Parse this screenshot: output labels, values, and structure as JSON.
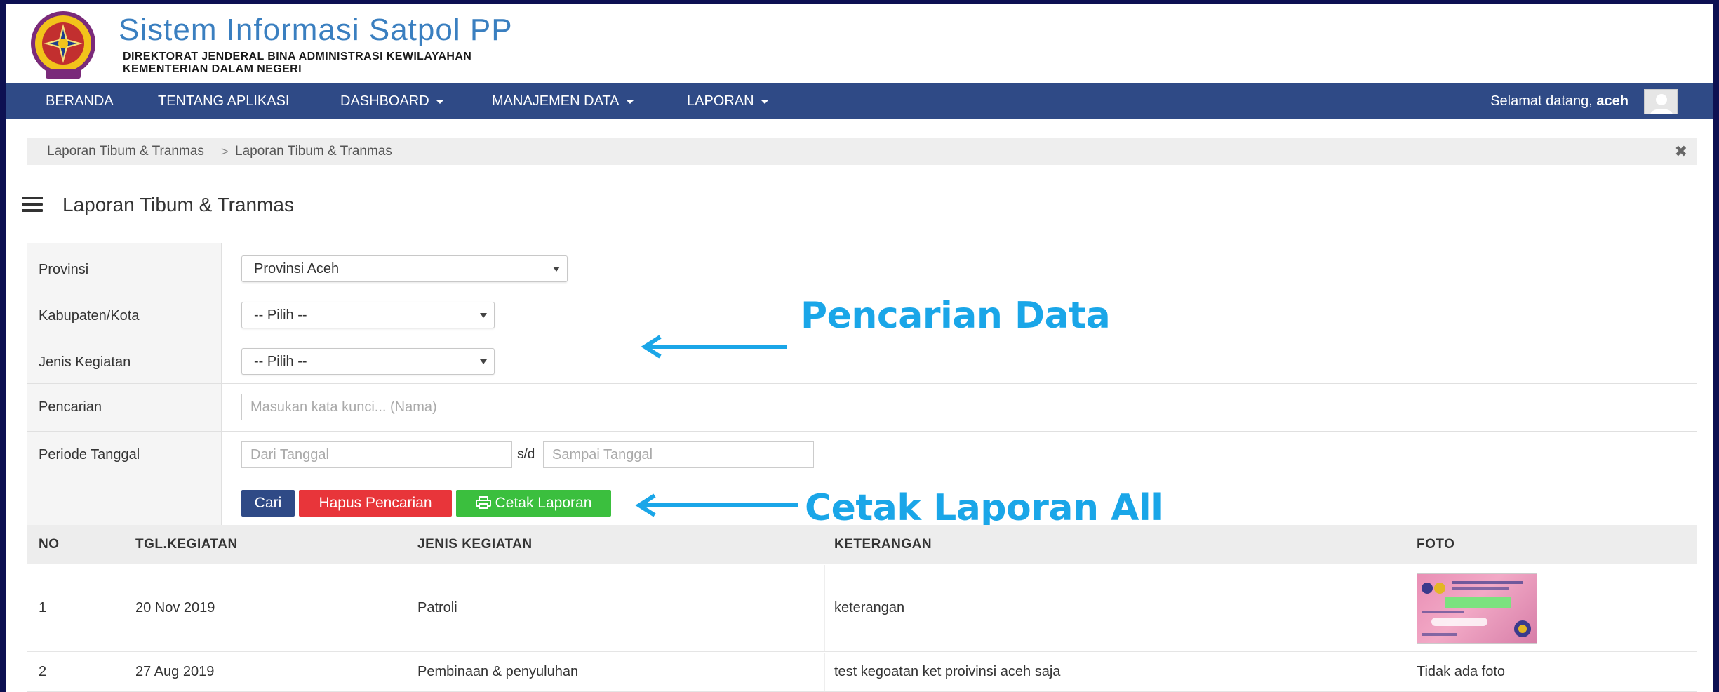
{
  "header": {
    "title": "Sistem Informasi Satpol PP",
    "subtitle_line1": "DIREKTORAT JENDERAL BINA ADMINISTRASI KEWILAYAHAN",
    "subtitle_line2": "KEMENTERIAN DALAM NEGERI"
  },
  "navbar": {
    "items": [
      {
        "label": "BERANDA",
        "dropdown": false
      },
      {
        "label": "TENTANG APLIKASI",
        "dropdown": false
      },
      {
        "label": "DASHBOARD",
        "dropdown": true
      },
      {
        "label": "MANAJEMEN DATA",
        "dropdown": true
      },
      {
        "label": "LAPORAN",
        "dropdown": true
      }
    ],
    "welcome_prefix": "Selamat datang,",
    "username": "aceh"
  },
  "breadcrumb": {
    "items": [
      "Laporan Tibum & Tranmas",
      "Laporan Tibum & Tranmas"
    ],
    "separator": ">",
    "close_glyph": "✖"
  },
  "page": {
    "title": "Laporan Tibum & Tranmas"
  },
  "filters": {
    "provinsi_label": "Provinsi",
    "provinsi_value": "Provinsi Aceh",
    "kabupaten_label": "Kabupaten/Kota",
    "kabupaten_value": "-- Pilih --",
    "jenis_label": "Jenis Kegiatan",
    "jenis_value": "-- Pilih --",
    "pencarian_label": "Pencarian",
    "pencarian_placeholder": "Masukan kata kunci... (Nama)",
    "periode_label": "Periode Tanggal",
    "dari_placeholder": "Dari Tanggal",
    "sd_label": "s/d",
    "sampai_placeholder": "Sampai Tanggal"
  },
  "buttons": {
    "cari": "Cari",
    "hapus": "Hapus Pencarian",
    "cetak": "Cetak Laporan"
  },
  "annotations": {
    "search": "Pencarian Data",
    "print": "Cetak Laporan All"
  },
  "table": {
    "columns": [
      "NO",
      "TGL.KEGIATAN",
      "JENIS KEGIATAN",
      "KETERANGAN",
      "FOTO"
    ],
    "rows": [
      {
        "no": "1",
        "tgl": "20 Nov 2019",
        "jenis": "Patroli",
        "keterangan": "keterangan",
        "foto": ""
      },
      {
        "no": "2",
        "tgl": "27 Aug 2019",
        "jenis": "Pembinaan & penyuluhan",
        "keterangan": "test kegoatan ket proivinsi aceh saja",
        "foto": "Tidak ada foto"
      }
    ]
  },
  "colors": {
    "navbar": "#2f4a86",
    "title_blue": "#3a7fc0",
    "annotation": "#1aa6e8",
    "btn_cari": "#2f4a86",
    "btn_hapus": "#e8353a",
    "btn_cetak": "#3bbf3e"
  }
}
